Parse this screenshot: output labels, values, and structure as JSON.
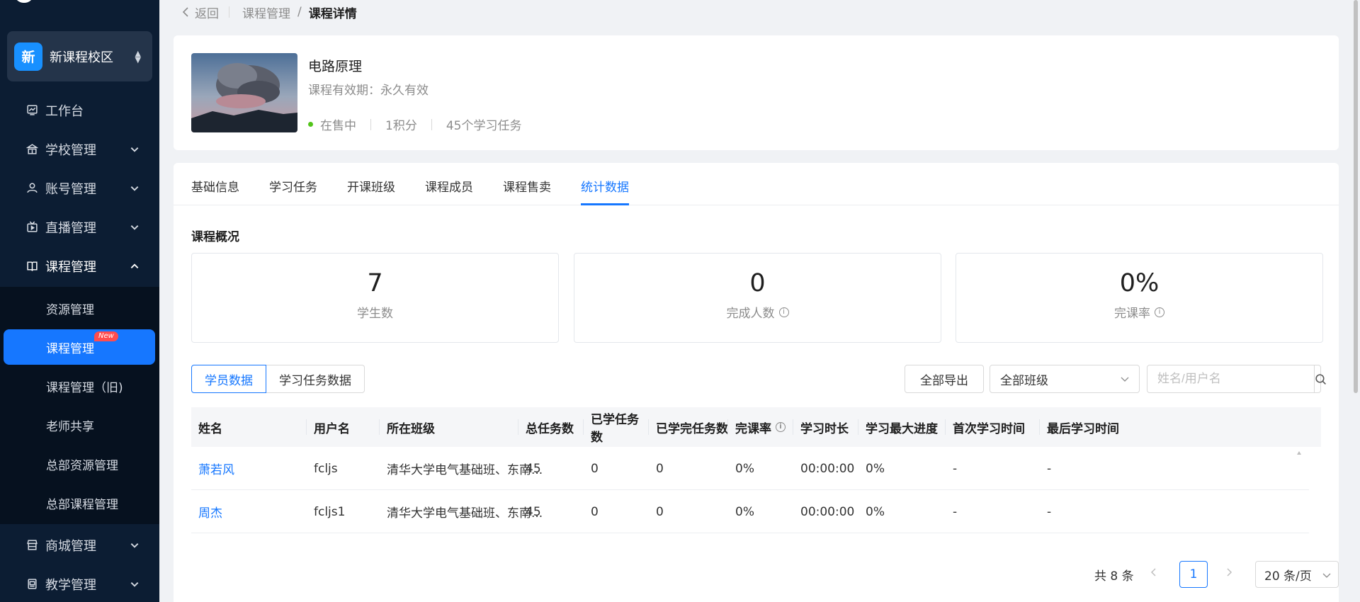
{
  "sidebar": {
    "campus": {
      "badge": "新",
      "name": "新课程校区"
    },
    "items": [
      {
        "label": "工作台",
        "icon": "dashboard-icon"
      },
      {
        "label": "学校管理",
        "icon": "school-icon"
      },
      {
        "label": "账号管理",
        "icon": "user-icon"
      },
      {
        "label": "直播管理",
        "icon": "live-icon"
      },
      {
        "label": "课程管理",
        "icon": "book-icon"
      },
      {
        "label": "商城管理",
        "icon": "shop-icon"
      },
      {
        "label": "教学管理",
        "icon": "teach-icon"
      }
    ],
    "sub_items": [
      {
        "label": "资源管理"
      },
      {
        "label": "课程管理",
        "badge": "New"
      },
      {
        "label": "课程管理（旧)"
      },
      {
        "label": "老师共享"
      },
      {
        "label": "总部资源管理"
      },
      {
        "label": "总部课程管理"
      }
    ]
  },
  "breadcrumb": {
    "back": "返回",
    "parent": "课程管理",
    "separator": "/",
    "current": "课程详情"
  },
  "course": {
    "title": "电路原理",
    "validity": "课程有效期：永久有效",
    "status": "在售中",
    "credits": "1积分",
    "tasks": "45个学习任务"
  },
  "tabs": [
    "基础信息",
    "学习任务",
    "开课班级",
    "课程成员",
    "课程售卖",
    "统计数据"
  ],
  "active_tab": "统计数据",
  "overview": {
    "title": "课程概况",
    "stats": [
      {
        "value": "7",
        "label": "学生数"
      },
      {
        "value": "0",
        "label": "完成人数"
      },
      {
        "value": "0%",
        "label": "完课率"
      }
    ]
  },
  "toolbar": {
    "seg_student": "学员数据",
    "seg_task": "学习任务数据",
    "export": "全部导出",
    "class_select": "全部班级",
    "search_placeholder": "姓名/用户名"
  },
  "table": {
    "headers": [
      "姓名",
      "用户名",
      "所在班级",
      "总任务数",
      "已学任务数",
      "已学完任务数",
      "完课率",
      "学习时长",
      "学习最大进度",
      "首次学习时间",
      "最后学习时间"
    ],
    "rows": [
      [
        "萧若风",
        "fcljs",
        "清华大学电气基础班、东南...",
        "45",
        "0",
        "0",
        "0%",
        "00:00:00",
        "0%",
        "-",
        "-"
      ],
      [
        "周杰",
        "fcljs1",
        "清华大学电气基础班、东南...",
        "45",
        "0",
        "0",
        "0%",
        "00:00:00",
        "0%",
        "-",
        "-"
      ]
    ]
  },
  "pager": {
    "total": "共 8 条",
    "page": "1",
    "size": "20 条/页"
  },
  "colors": {
    "primary": "#1677ff",
    "sidebar_bg": "#0c1d33",
    "success": "#52c41a"
  }
}
